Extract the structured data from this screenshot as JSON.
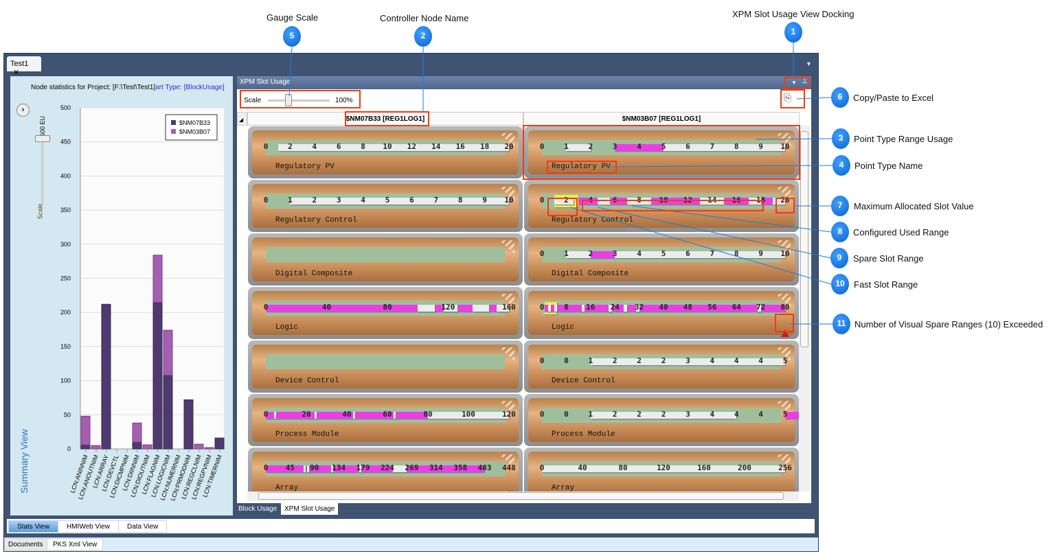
{
  "window": {
    "tab": "Test1"
  },
  "summary": {
    "title_a": "Node statistics for Project: [F:\\Test\\Test1]",
    "title_b": "art Type: [BlockUsage]",
    "side_label": "Summary View",
    "scale_label": "Scale",
    "scale_value": "500 EU",
    "expand_icon": "chevron-right-icon"
  },
  "chart_data": {
    "type": "bar",
    "stacked": true,
    "ylim": [
      0,
      500
    ],
    "yticks": [
      0,
      50,
      100,
      150,
      200,
      250,
      300,
      350,
      400,
      450,
      500
    ],
    "grid": true,
    "legend_position": "top-right",
    "categories": [
      "LCN:ANINNIM",
      "LCN:ANOUTNIM",
      "LCN:ARRAY",
      "LCN:DEVCTL",
      "LCN:DICMPNIM",
      "LCN:DIINNIM",
      "LCN:DIOUTNIM",
      "LCN:FLAGNIM",
      "LCN:LOGICNIM",
      "LCN:NUMERNIM",
      "LCN:PRMODNIM",
      "LCN:REGCLNIM",
      "LCN:REGPVNIM",
      "LCN:TIMERNIM"
    ],
    "series": [
      {
        "name": "$NM07B33",
        "color": "#4e3a6e",
        "values": [
          6,
          0,
          212,
          0,
          0,
          10,
          0,
          215,
          108,
          0,
          72,
          0,
          0,
          16
        ]
      },
      {
        "name": "$NM03B07",
        "color": "#a45fb0",
        "values": [
          42,
          5,
          0,
          0,
          0,
          28,
          6,
          69,
          66,
          0,
          0,
          7,
          2,
          0
        ]
      }
    ]
  },
  "xpm": {
    "title": "XPM Slot Usage",
    "scale_label": "Scale",
    "scale_value": "100%",
    "scale_percent": 100,
    "columns": [
      {
        "name": "$NM07B33 [REG1LOG1]",
        "gauges": [
          {
            "name": "Regulatory PV",
            "ticks": [
              "0",
              "2",
              "4",
              "6",
              "8",
              "10",
              "12",
              "14",
              "16",
              "18",
              "20"
            ],
            "max": 20,
            "segments": [
              [
                "spare",
                1,
                20
              ]
            ]
          },
          {
            "name": "Regulatory Control",
            "ticks": [
              "0",
              "1",
              "2",
              "3",
              "4",
              "5",
              "6",
              "7",
              "8",
              "9",
              "10"
            ],
            "max": 10,
            "segments": [
              [
                "spare",
                1,
                10
              ]
            ]
          },
          {
            "name": "Digital Composite",
            "ticks": [],
            "max": 1,
            "segments": []
          },
          {
            "name": "Logic",
            "ticks": [
              "0",
              "40",
              "80",
              "120",
              "160"
            ],
            "max": 160,
            "segments": [
              [
                "used",
                0,
                159
              ],
              [
                "spare",
                100,
                111
              ],
              [
                "spare",
                117,
                126
              ],
              [
                "spare",
                136,
                147
              ],
              [
                "spare",
                152,
                160
              ]
            ]
          },
          {
            "name": "Device Control",
            "ticks": [],
            "max": 1,
            "segments": []
          },
          {
            "name": "Process Module",
            "ticks": [
              "0",
              "20",
              "40",
              "60",
              "80",
              "100",
              "120"
            ],
            "max": 120,
            "segments": [
              [
                "used",
                0,
                80
              ],
              [
                "spare",
                4,
                5
              ],
              [
                "spare",
                24,
                25
              ],
              [
                "spare",
                43,
                44
              ],
              [
                "spare",
                63,
                64
              ],
              [
                "spare",
                80,
                120
              ]
            ]
          },
          {
            "name": "Array",
            "ticks": [
              "0",
              "45",
              "90",
              "134",
              "179",
              "224",
              "269",
              "314",
              "358",
              "403",
              "448"
            ],
            "max": 448,
            "warning": true,
            "segments": [
              [
                "used",
                0,
                403
              ],
              [
                "spare",
                70,
                74
              ],
              [
                "spare",
                76,
                80
              ],
              [
                "spare",
                120,
                124
              ],
              [
                "spare",
                172,
                176
              ],
              [
                "spare",
                234,
                260
              ]
            ]
          }
        ]
      },
      {
        "name": "$NM03B07 [REG1LOG1]",
        "gauges": [
          {
            "name": "Regulatory PV",
            "ticks": [
              "0",
              "1",
              "2",
              "3",
              "4",
              "5",
              "6",
              "7",
              "8",
              "9",
              "10"
            ],
            "max": 10,
            "segments": [
              [
                "spare",
                1,
                2
              ],
              [
                "used",
                3,
                5
              ],
              [
                "spare",
                5,
                10
              ]
            ]
          },
          {
            "name": "Regulatory Control",
            "ticks": [
              "0",
              "2",
              "4",
              "6",
              "8",
              "10",
              "12",
              "14",
              "16",
              "18",
              "20"
            ],
            "max": 20,
            "segments": [
              [
                "fast",
                1,
                3
              ],
              [
                "spare",
                1,
                2.6
              ],
              [
                "used",
                3,
                4.6
              ],
              [
                "spare",
                4.6,
                5.6
              ],
              [
                "used",
                5.6,
                7
              ],
              [
                "spare",
                7,
                9
              ],
              [
                "used",
                9,
                13
              ],
              [
                "spare",
                13,
                15
              ],
              [
                "used",
                15,
                17
              ],
              [
                "spare",
                17,
                18
              ],
              [
                "used",
                18,
                19
              ],
              [
                "spare",
                19,
                20
              ]
            ]
          },
          {
            "name": "Digital Composite",
            "ticks": [
              "0",
              "1",
              "2",
              "3",
              "4",
              "5",
              "6",
              "7",
              "8",
              "9",
              "10"
            ],
            "max": 10,
            "segments": [
              [
                "spare",
                1,
                2
              ],
              [
                "used",
                2,
                3
              ],
              [
                "spare",
                3,
                10
              ]
            ]
          },
          {
            "name": "Logic",
            "ticks": [
              "0",
              "8",
              "16",
              "24",
              "32",
              "40",
              "48",
              "56",
              "64",
              "72",
              "80"
            ],
            "max": 80,
            "warning": true,
            "segments": [
              [
                "fast",
                1,
                5
              ],
              [
                "used",
                1,
                80
              ],
              [
                "spare",
                2,
                3
              ],
              [
                "spare",
                4,
                5
              ],
              [
                "spare",
                13,
                14
              ],
              [
                "spare",
                22,
                23
              ],
              [
                "spare",
                27,
                28
              ],
              [
                "spare",
                31,
                32
              ],
              [
                "spare",
                71,
                72
              ]
            ]
          },
          {
            "name": "Device Control",
            "ticks": [
              "0",
              "0",
              "1",
              "2",
              "2",
              "2",
              "3",
              "4",
              "4",
              "4",
              "5"
            ],
            "max": 5,
            "segments": [
              [
                "spare",
                1,
                5
              ]
            ]
          },
          {
            "name": "Process Module",
            "ticks": [
              "0",
              "0",
              "1",
              "2",
              "2",
              "2",
              "3",
              "4",
              "4",
              "4",
              "5"
            ],
            "max": 5,
            "segments": [
              [
                "spare",
                1,
                4
              ],
              [
                "used",
                5,
                5.3
              ]
            ]
          },
          {
            "name": "Array",
            "ticks": [
              "0",
              "40",
              "80",
              "120",
              "160",
              "200",
              "256"
            ],
            "max": 256,
            "segments": [
              [
                "spare",
                0,
                256
              ]
            ]
          }
        ]
      }
    ],
    "colors": {
      "used": "#ee3ce8",
      "spare": "#ececec",
      "fast": "#f0f040"
    }
  },
  "bottom_tabs": [
    "Block Usage",
    "XPM Slot Usage"
  ],
  "view_tabs": [
    "Stats View",
    "HMIWeb View",
    "Data View"
  ],
  "doc_tabs": [
    "Documents",
    "PKS Xml View"
  ],
  "callouts": [
    {
      "n": "1",
      "label": "XPM Slot Usage View Docking"
    },
    {
      "n": "2",
      "label": "Controller Node Name"
    },
    {
      "n": "3",
      "label": "Point Type Range Usage"
    },
    {
      "n": "4",
      "label": "Point Type Name"
    },
    {
      "n": "5",
      "label": "Gauge Scale"
    },
    {
      "n": "6",
      "label": "Copy/Paste to Excel"
    },
    {
      "n": "7",
      "label": "Maximum Allocated Slot Value"
    },
    {
      "n": "8",
      "label": "Configured Used Range"
    },
    {
      "n": "9",
      "label": "Spare Slot Range"
    },
    {
      "n": "10",
      "label": "Fast Slot Range"
    },
    {
      "n": "11",
      "label": "Number of Visual Spare Ranges (10) Exceeded"
    }
  ]
}
